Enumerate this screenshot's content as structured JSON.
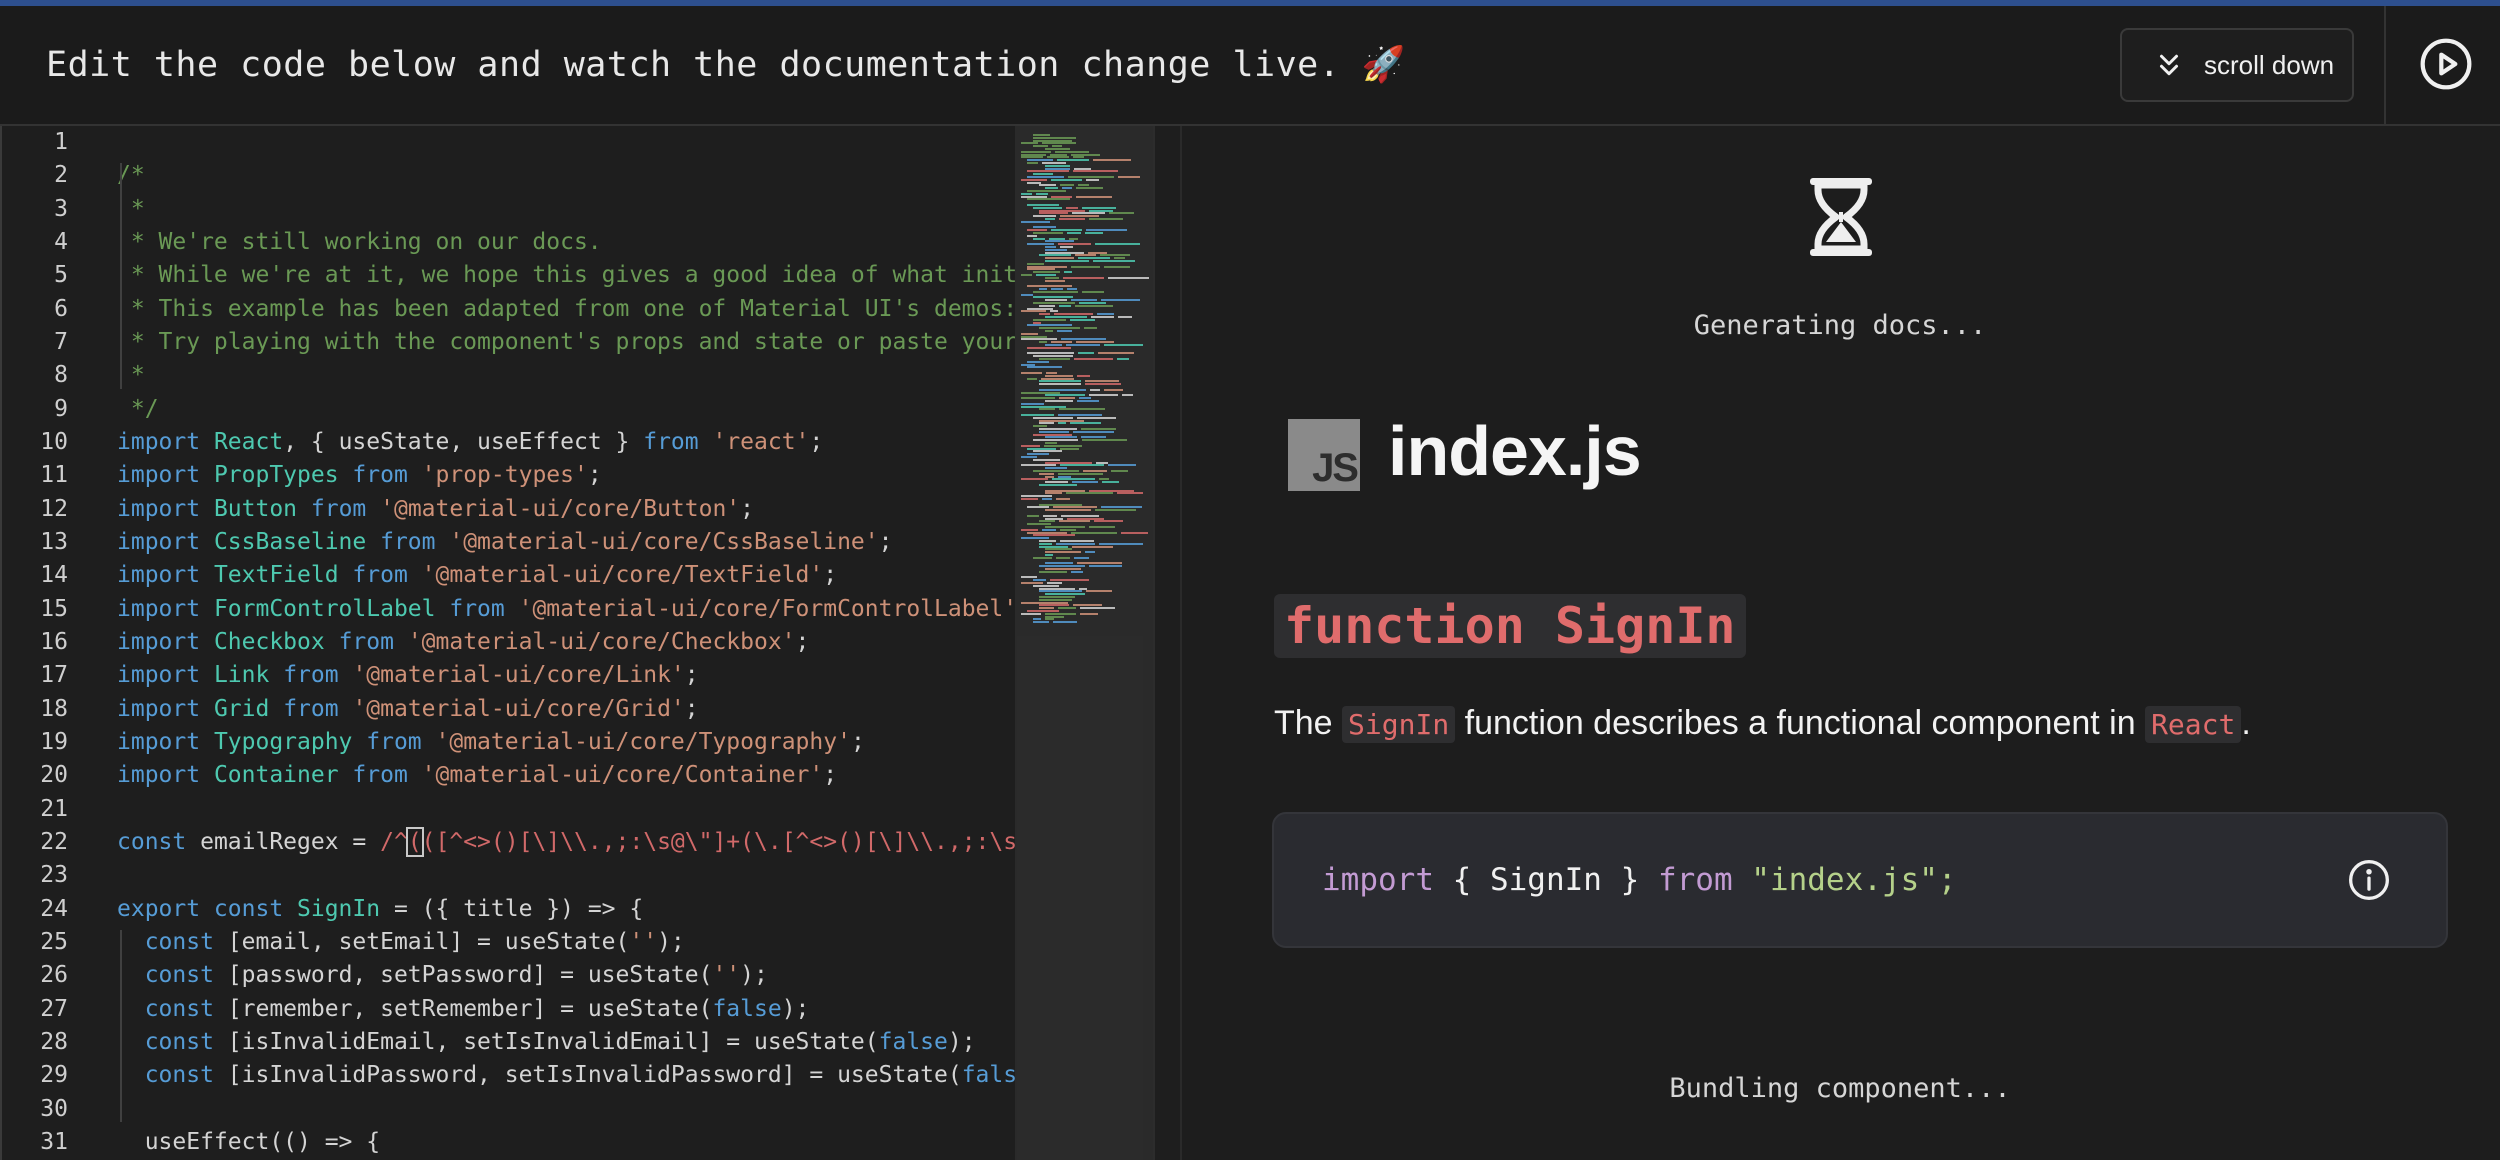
{
  "header": {
    "title": "Edit the code below and watch the documentation change live. 🚀",
    "scroll_button_label": "scroll down",
    "scroll_icon": "chevron-double-down-icon",
    "play_icon": "play-circle-icon"
  },
  "editor": {
    "lines": [
      {
        "n": "1",
        "tokens": []
      },
      {
        "n": "2",
        "tokens": [
          [
            "c-cm",
            "/*"
          ]
        ]
      },
      {
        "n": "3",
        "tokens": [
          [
            "c-cm",
            " *"
          ]
        ]
      },
      {
        "n": "4",
        "tokens": [
          [
            "c-cm",
            " * We're still working on our docs."
          ]
        ]
      },
      {
        "n": "5",
        "tokens": [
          [
            "c-cm",
            " * While we're at it, we hope this gives a good idea of what init does"
          ]
        ]
      },
      {
        "n": "6",
        "tokens": [
          [
            "c-cm",
            " * This example has been adapted from one of Material UI's demos: https"
          ]
        ]
      },
      {
        "n": "7",
        "tokens": [
          [
            "c-cm",
            " * Try playing with the component's props and state or paste your own"
          ]
        ]
      },
      {
        "n": "8",
        "tokens": [
          [
            "c-cm",
            " *"
          ]
        ]
      },
      {
        "n": "9",
        "tokens": [
          [
            "c-cm",
            " */"
          ]
        ]
      },
      {
        "n": "10",
        "tokens": [
          [
            "c-kw",
            "import "
          ],
          [
            "c-id",
            "React"
          ],
          [
            "c-tx",
            ", { useState, useEffect } "
          ],
          [
            "c-kw",
            "from "
          ],
          [
            "c-st",
            "'react'"
          ],
          [
            "c-tx",
            ";"
          ]
        ]
      },
      {
        "n": "11",
        "tokens": [
          [
            "c-kw",
            "import "
          ],
          [
            "c-id",
            "PropTypes "
          ],
          [
            "c-kw",
            "from "
          ],
          [
            "c-st",
            "'prop-types'"
          ],
          [
            "c-tx",
            ";"
          ]
        ]
      },
      {
        "n": "12",
        "tokens": [
          [
            "c-kw",
            "import "
          ],
          [
            "c-id",
            "Button "
          ],
          [
            "c-kw",
            "from "
          ],
          [
            "c-st",
            "'@material-ui/core/Button'"
          ],
          [
            "c-tx",
            ";"
          ]
        ]
      },
      {
        "n": "13",
        "tokens": [
          [
            "c-kw",
            "import "
          ],
          [
            "c-id",
            "CssBaseline "
          ],
          [
            "c-kw",
            "from "
          ],
          [
            "c-st",
            "'@material-ui/core/CssBaseline'"
          ],
          [
            "c-tx",
            ";"
          ]
        ]
      },
      {
        "n": "14",
        "tokens": [
          [
            "c-kw",
            "import "
          ],
          [
            "c-id",
            "TextField "
          ],
          [
            "c-kw",
            "from "
          ],
          [
            "c-st",
            "'@material-ui/core/TextField'"
          ],
          [
            "c-tx",
            ";"
          ]
        ]
      },
      {
        "n": "15",
        "tokens": [
          [
            "c-kw",
            "import "
          ],
          [
            "c-id",
            "FormControlLabel "
          ],
          [
            "c-kw",
            "from "
          ],
          [
            "c-st",
            "'@material-ui/core/FormControlLabel'"
          ],
          [
            "c-tx",
            ";"
          ]
        ]
      },
      {
        "n": "16",
        "tokens": [
          [
            "c-kw",
            "import "
          ],
          [
            "c-id",
            "Checkbox "
          ],
          [
            "c-kw",
            "from "
          ],
          [
            "c-st",
            "'@material-ui/core/Checkbox'"
          ],
          [
            "c-tx",
            ";"
          ]
        ]
      },
      {
        "n": "17",
        "tokens": [
          [
            "c-kw",
            "import "
          ],
          [
            "c-id",
            "Link "
          ],
          [
            "c-kw",
            "from "
          ],
          [
            "c-st",
            "'@material-ui/core/Link'"
          ],
          [
            "c-tx",
            ";"
          ]
        ]
      },
      {
        "n": "18",
        "tokens": [
          [
            "c-kw",
            "import "
          ],
          [
            "c-id",
            "Grid "
          ],
          [
            "c-kw",
            "from "
          ],
          [
            "c-st",
            "'@material-ui/core/Grid'"
          ],
          [
            "c-tx",
            ";"
          ]
        ]
      },
      {
        "n": "19",
        "tokens": [
          [
            "c-kw",
            "import "
          ],
          [
            "c-id",
            "Typography "
          ],
          [
            "c-kw",
            "from "
          ],
          [
            "c-st",
            "'@material-ui/core/Typography'"
          ],
          [
            "c-tx",
            ";"
          ]
        ]
      },
      {
        "n": "20",
        "tokens": [
          [
            "c-kw",
            "import "
          ],
          [
            "c-id",
            "Container "
          ],
          [
            "c-kw",
            "from "
          ],
          [
            "c-st",
            "'@material-ui/core/Container'"
          ],
          [
            "c-tx",
            ";"
          ]
        ]
      },
      {
        "n": "21",
        "tokens": []
      },
      {
        "n": "22",
        "tokens": [
          [
            "c-kw",
            "const "
          ],
          [
            "c-tx",
            "emailRegex = "
          ],
          [
            "c-re",
            "/^"
          ],
          [
            "c-re cursorbox",
            "("
          ],
          [
            "c-re",
            "([^<>()[\\]\\\\.,;:\\s@\\\"]+(\\.[^<>()[\\]\\\\.,;:\\s@\\\"]+)*)"
          ]
        ]
      },
      {
        "n": "23",
        "tokens": []
      },
      {
        "n": "24",
        "tokens": [
          [
            "c-kw",
            "export const "
          ],
          [
            "c-id",
            "SignIn"
          ],
          [
            "c-tx",
            " = ({ title }) => {"
          ]
        ]
      },
      {
        "n": "25",
        "tokens": [
          [
            "c-tx",
            "  "
          ],
          [
            "c-kw",
            "const "
          ],
          [
            "c-tx",
            "[email, setEmail] = useState("
          ],
          [
            "c-st",
            "''"
          ],
          [
            "c-tx",
            ");"
          ]
        ]
      },
      {
        "n": "26",
        "tokens": [
          [
            "c-tx",
            "  "
          ],
          [
            "c-kw",
            "const "
          ],
          [
            "c-tx",
            "[password, setPassword] = useState("
          ],
          [
            "c-st",
            "''"
          ],
          [
            "c-tx",
            ");"
          ]
        ]
      },
      {
        "n": "27",
        "tokens": [
          [
            "c-tx",
            "  "
          ],
          [
            "c-kw",
            "const "
          ],
          [
            "c-tx",
            "[remember, setRemember] = useState("
          ],
          [
            "c-fa",
            "false"
          ],
          [
            "c-tx",
            ");"
          ]
        ]
      },
      {
        "n": "28",
        "tokens": [
          [
            "c-tx",
            "  "
          ],
          [
            "c-kw",
            "const "
          ],
          [
            "c-tx",
            "[isInvalidEmail, setIsInvalidEmail] = useState("
          ],
          [
            "c-fa",
            "false"
          ],
          [
            "c-tx",
            ");"
          ]
        ]
      },
      {
        "n": "29",
        "tokens": [
          [
            "c-tx",
            "  "
          ],
          [
            "c-kw",
            "const "
          ],
          [
            "c-tx",
            "[isInvalidPassword, setIsInvalidPassword] = useState("
          ],
          [
            "c-fa",
            "false"
          ],
          [
            "c-tx",
            ");"
          ]
        ]
      },
      {
        "n": "30",
        "tokens": []
      },
      {
        "n": "31",
        "tokens": [
          [
            "c-tx",
            "  useEffect(() => {"
          ]
        ]
      }
    ]
  },
  "docs": {
    "generating_text": "Generating docs...",
    "hourglass_icon": "hourglass-icon",
    "file_logo_text": "JS",
    "file_title": "index.js",
    "function_heading": "function SignIn",
    "desc_prefix": "The ",
    "desc_code1": "SignIn",
    "desc_middle": " function describes a functional component in ",
    "desc_code2": "React",
    "desc_suffix": ".",
    "import_kw": "import",
    "import_names": " { SignIn } ",
    "import_from": "from",
    "import_space": " ",
    "import_path": "\"index.js\"",
    "import_semi": ";",
    "info_icon": "info-circle-icon",
    "bundling_text": "Bundling component..."
  },
  "colors": {
    "accent_bar": "#2d4f8e",
    "comment": "#6a9955",
    "keyword": "#569cd6",
    "identifier": "#4ec9b0",
    "string": "#ce9178",
    "heading_red": "#e06c6c"
  }
}
